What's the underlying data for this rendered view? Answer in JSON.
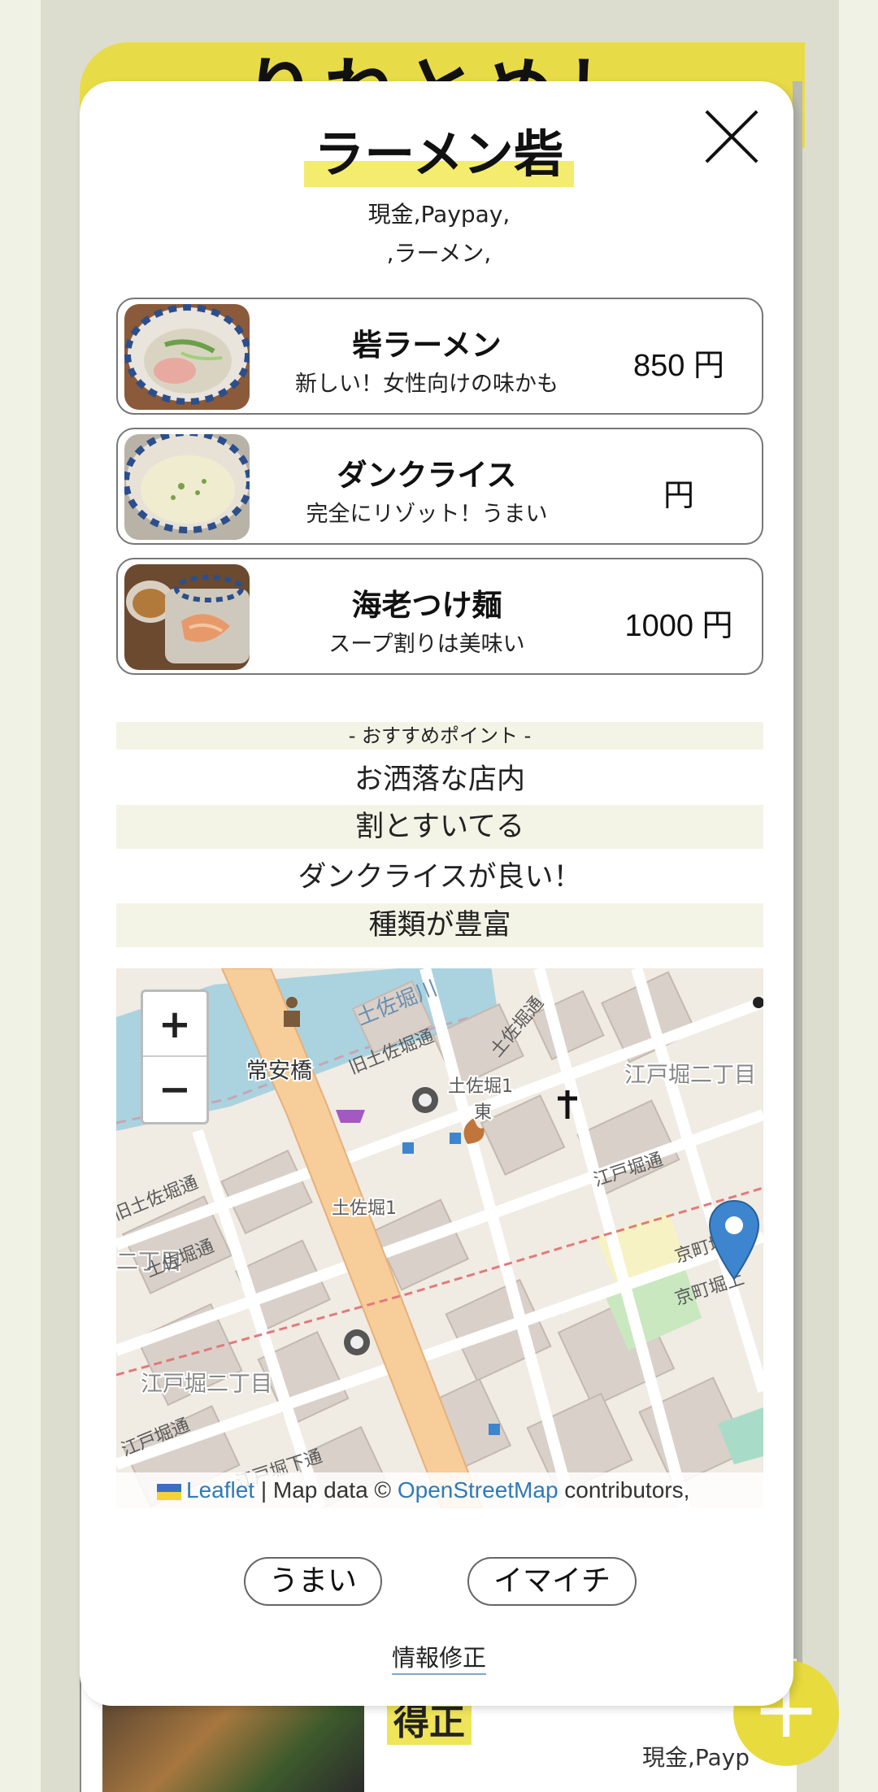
{
  "background_page": {
    "header_title": "りねとめし",
    "card_name": "得正",
    "card_payment": "現金,Payp"
  },
  "modal": {
    "shop_name": "ラーメン砦",
    "payment_line": "現金,Paypay,",
    "genre_line": ",ラーメン,",
    "menu": [
      {
        "name": "砦ラーメン",
        "desc": "新しい！女性向けの味かも",
        "price": "850 円"
      },
      {
        "name": "ダンクライス",
        "desc": "完全にリゾット！うまい",
        "price": "円"
      },
      {
        "name": "海老つけ麺",
        "desc": "スープ割りは美味い",
        "price": "1000 円"
      }
    ],
    "points_header": "- おすすめポイント -",
    "points": [
      "お洒落な店内",
      "割とすいてる",
      "ダンクライスが良い！",
      "種類が豊富"
    ],
    "map": {
      "zoom_in": "+",
      "zoom_out": "−",
      "labels": {
        "bridge": "常安橋",
        "river": "土佐堀川",
        "street1": "旧土佐堀通",
        "street2": "土佐堀通",
        "area1": "土佐堀1",
        "area2": "土佐堀1",
        "area3": "東",
        "area4": "江戸堀二丁目",
        "area5": "江戸堀二丁目",
        "area6": "江戸堀通",
        "area7": "江戸堀下通",
        "area8": "京町堀",
        "area9": "二丁目",
        "street3": "旧土佐堀通",
        "street4": "土佐堀通",
        "street5": "江戸堀通",
        "street6": "京町堀上"
      },
      "attribution": {
        "leaflet": "Leaflet",
        "middle": " | Map data © ",
        "osm": "OpenStreetMap",
        "tail": " contributors,"
      }
    },
    "buttons": {
      "good": "うまい",
      "bad": "イマイチ"
    },
    "edit_link": "情報修正"
  },
  "fab_label": "+",
  "colors": {
    "accent_yellow": "#e8db3e",
    "row_shade": "#f3f4e6",
    "link_blue": "#2f7ab8",
    "marker_blue": "#3d86cf"
  }
}
